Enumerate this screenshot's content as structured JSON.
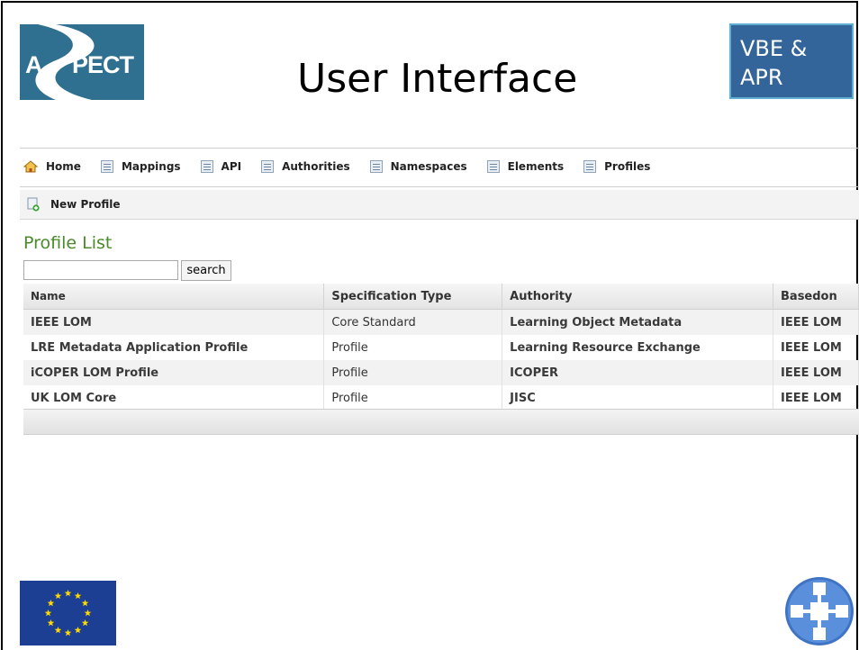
{
  "slide": {
    "title": "User Interface",
    "badge_line1": "VBE &",
    "badge_line2": "APR",
    "logo_text_a": "A",
    "logo_text_rest": "PECT"
  },
  "nav": {
    "items": [
      {
        "label": "Home",
        "icon": "home-icon"
      },
      {
        "label": "Mappings",
        "icon": "document-icon"
      },
      {
        "label": "API",
        "icon": "document-icon"
      },
      {
        "label": "Authorities",
        "icon": "document-icon"
      },
      {
        "label": "Namespaces",
        "icon": "document-icon"
      },
      {
        "label": "Elements",
        "icon": "document-icon"
      },
      {
        "label": "Profiles",
        "icon": "document-icon"
      }
    ]
  },
  "toolbar": {
    "new_profile_label": "New Profile"
  },
  "profile_list": {
    "title": "Profile List",
    "search_value": "",
    "search_button": "search",
    "columns": [
      "Name",
      "Specification Type",
      "Authority",
      "Basedon"
    ],
    "rows": [
      [
        "IEEE LOM",
        "Core Standard",
        "Learning Object Metadata",
        "IEEE LOM"
      ],
      [
        "LRE Metadata Application Profile",
        "Profile",
        "Learning Resource Exchange",
        "IEEE LOM"
      ],
      [
        "iCOPER LOM Profile",
        "Profile",
        "ICOPER",
        "IEEE LOM"
      ],
      [
        "UK LOM Core",
        "Profile",
        "JISC",
        "IEEE LOM"
      ]
    ]
  },
  "colors": {
    "badge_bg": "#34659a",
    "title_green": "#4a8a2a",
    "logo_bg": "#2f6f8f",
    "eu_blue": "#1c3f94",
    "eu_star": "#ffd800"
  }
}
